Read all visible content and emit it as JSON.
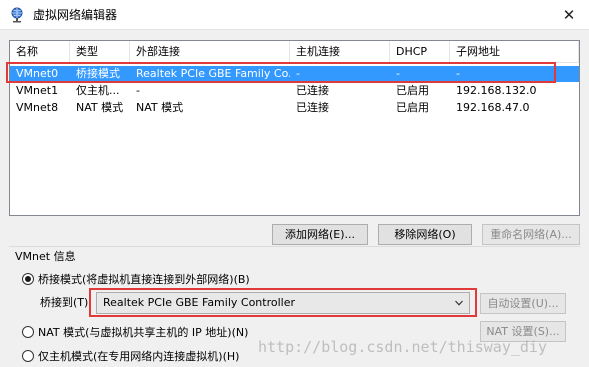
{
  "window": {
    "title": "虚拟网络编辑器",
    "close_glyph": "✕"
  },
  "table": {
    "headers": [
      "名称",
      "类型",
      "外部连接",
      "主机连接",
      "DHCP",
      "子网地址"
    ],
    "rows": [
      [
        "VMnet0",
        "桥接模式",
        "Realtek PCIe GBE Family Co...",
        "-",
        "-",
        "-"
      ],
      [
        "VMnet1",
        "仅主机...",
        "-",
        "已连接",
        "已启用",
        "192.168.132.0"
      ],
      [
        "VMnet8",
        "NAT 模式",
        "NAT 模式",
        "已连接",
        "已启用",
        "192.168.47.0"
      ]
    ],
    "selected_row": 0
  },
  "buttons": {
    "add_network": "添加网络(E)...",
    "remove_network": "移除网络(O)",
    "rename_network": "重命名网络(A)..."
  },
  "vmnet_info": {
    "group_label": "VMnet 信息",
    "bridged_option": "桥接模式(将虚拟机直接连接到外部网络)(B)",
    "bridged_to_label": "桥接到(T):",
    "bridged_to_value": "Realtek PCIe GBE Family Controller",
    "auto_settings": "自动设置(U)...",
    "nat_option": "NAT 模式(与虚拟机共享主机的 IP 地址)(N)",
    "nat_settings": "NAT 设置(S)...",
    "host_only_option": "仅主机模式(在专用网络内连接虚拟机)(H)",
    "selected_mode": "bridged"
  },
  "watermark": "http://blog.csdn.net/thisway_diy",
  "colors": {
    "selection": "#3399ff",
    "highlight_box": "#e03a3a"
  },
  "icons": {
    "app": "network-globe-icon",
    "dropdown": "chevron-down-icon"
  }
}
